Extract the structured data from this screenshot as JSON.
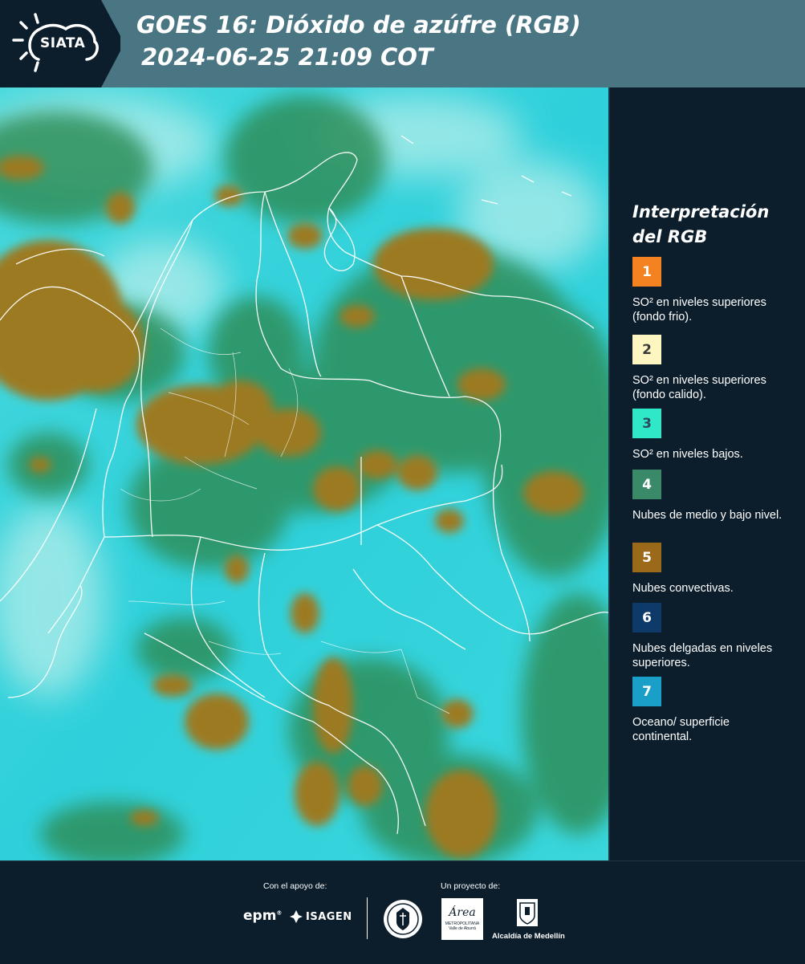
{
  "header": {
    "logo_text": "SIATA",
    "title_line1": "GOES 16: Dióxido de azúfre (RGB)",
    "title_line2": "2024-06-25 21:09 COT"
  },
  "legend": {
    "title": "Interpretación del RGB",
    "items": [
      {
        "number": "1",
        "label": "SO² en niveles superiores (fondo frio).",
        "color": "#f58220",
        "text_color": "#ffffff"
      },
      {
        "number": "2",
        "label": "SO² en niveles superiores (fondo calido).",
        "color": "#fdf6c0",
        "text_color": "#3a3a3a"
      },
      {
        "number": "3",
        "label": "SO² en niveles bajos.",
        "color": "#2ee8c8",
        "text_color": "#2c4c5c"
      },
      {
        "number": "4",
        "label": "Nubes de medio y bajo nivel.",
        "color": "#3a8a6a",
        "text_color": "#ffffff"
      },
      {
        "number": "5",
        "label": "Nubes convectivas.",
        "color": "#9a6a1a",
        "text_color": "#ffffff"
      },
      {
        "number": "6",
        "label": "Nubes delgadas en niveles superiores.",
        "color": "#0e3a6a",
        "text_color": "#ffffff"
      },
      {
        "number": "7",
        "label": "Oceano/ superficie continental.",
        "color": "#1aa0c8",
        "text_color": "#ffffff"
      }
    ]
  },
  "footer": {
    "support_caption": "Con el apoyo de:",
    "project_caption": "Un proyecto de:",
    "epm_logo": "epm",
    "isagen_logo": "ISAGEN",
    "area_logo_word": "Área",
    "area_logo_sub1": "METROPOLITANA",
    "area_logo_sub2": "Valle de Aburrá",
    "alcaldia_logo": "Alcaldía de Medellín"
  },
  "colors": {
    "background": "#0c1e2c",
    "header": "#4a7583",
    "map_sky": "#30d2dc",
    "map_convective": "#9c7a22",
    "map_midlevel": "#2f8f5a"
  }
}
